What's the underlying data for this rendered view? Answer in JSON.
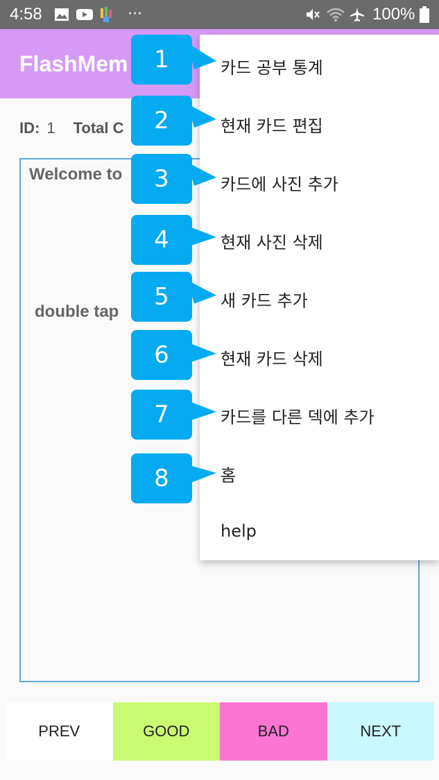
{
  "status_bar": {
    "time": "4:58",
    "dots": "···",
    "battery": "100%",
    "icons": [
      "image-icon",
      "youtube-icon",
      "apps-icon",
      "mute-icon",
      "wifi-icon",
      "airplane-icon",
      "battery-icon"
    ]
  },
  "app_bar": {
    "title": "FlashMem"
  },
  "info": {
    "id_label": "ID:",
    "id_value": "1",
    "total_label": "Total C"
  },
  "card": {
    "welcome_text": "Welcome to",
    "hint_text": "double tap"
  },
  "menu": {
    "items": [
      "카드 공부 통계",
      "현재 카드 편집",
      "카드에 사진 추가",
      "현재 사진 삭제",
      "새 카드 추가",
      "현재 카드 삭제",
      "카드를 다른 덱에 추가",
      "홈",
      "help"
    ]
  },
  "badges": [
    "1",
    "2",
    "3",
    "4",
    "5",
    "6",
    "7",
    "8"
  ],
  "buttons": {
    "prev": "PREV",
    "good": "GOOD",
    "bad": "BAD",
    "next": "NEXT"
  },
  "colors": {
    "app_bar": "#d59af6",
    "badge": "#05aaf0",
    "prev": "#ffffff",
    "good": "#c9fb72",
    "bad": "#fb74d4",
    "next": "#c9f8ff",
    "card_border": "#5aa7d6"
  }
}
